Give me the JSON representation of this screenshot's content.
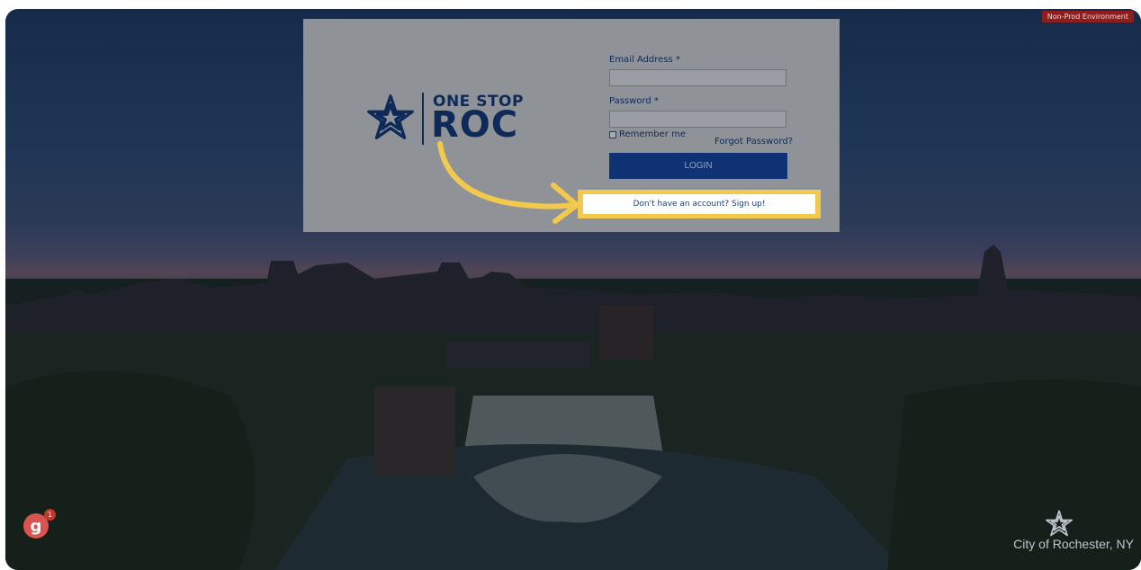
{
  "environment_badge": "Non-Prod Environment",
  "brand": {
    "line1": "ONE STOP",
    "line2": "ROC",
    "color": "#0d2a58"
  },
  "form": {
    "email_label": "Email Address *",
    "email_value": "",
    "password_label": "Password *",
    "password_value": "",
    "remember_label": "Remember me",
    "forgot_label": "Forgot Password?",
    "login_label": "LOGIN",
    "signup_label": "Don't have an account? Sign up!"
  },
  "footer": {
    "city_text": "City of Rochester, NY"
  },
  "guide_badge": {
    "letter": "g",
    "count": "1"
  },
  "colors": {
    "highlight": "#f2c94c",
    "login_button": "#0f3275",
    "env_badge": "#8e1d1d"
  },
  "icons": {
    "brand": "rochester-flower-icon",
    "annotation": "curved-arrow-icon",
    "footer": "rochester-flower-icon"
  }
}
